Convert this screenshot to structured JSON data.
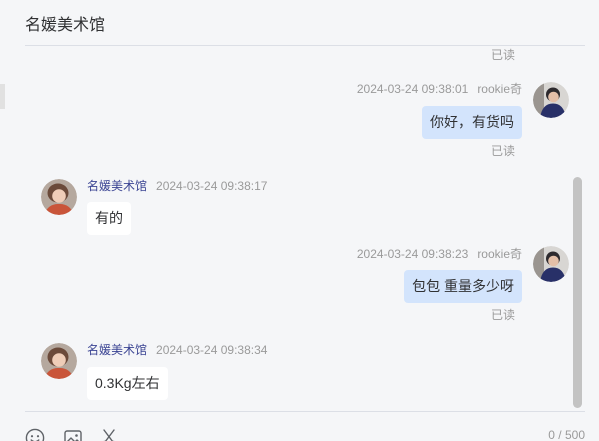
{
  "header": {
    "title": "名媛美术馆"
  },
  "earlier_message": {
    "read_status": "已读"
  },
  "messages": [
    {
      "sender": "rookie奇",
      "time": "2024-03-24 09:38:01",
      "text": "你好，有货吗",
      "read_status": "已读"
    },
    {
      "sender": "名媛美术馆",
      "time": "2024-03-24 09:38:17",
      "text": "有的"
    },
    {
      "sender": "rookie奇",
      "time": "2024-03-24 09:38:23",
      "text": "包包 重量多少呀",
      "read_status": "已读"
    },
    {
      "sender": "名媛美术馆",
      "time": "2024-03-24 09:38:34",
      "text": "0.3Kg左右"
    }
  ],
  "toolbar": {
    "emoji": {
      "icon": "emoji-icon"
    },
    "image": {
      "icon": "image-icon"
    },
    "scissors": {
      "icon": "scissors-icon"
    },
    "char_counter": "0 / 500"
  },
  "colors": {
    "background": "#f5f6f8",
    "sent-bubble": "#d3e4fc",
    "received-bubble": "#ffffff",
    "sender-name": "#3b4493",
    "muted-text": "#9a9a9a",
    "divider": "#dcdfe6",
    "icon": "#5f6368",
    "scrollbar-thumb": "#c3c3c3"
  }
}
